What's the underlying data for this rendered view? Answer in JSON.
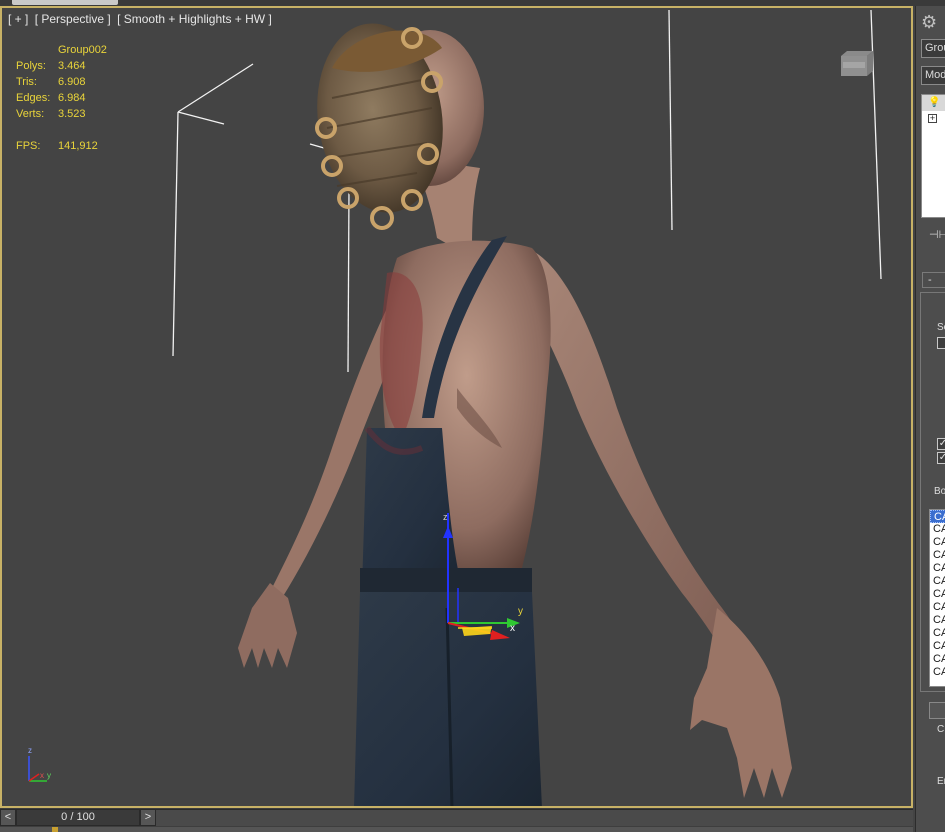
{
  "viewport": {
    "label_parts": [
      "[ + ]",
      "[ Perspective ]",
      "[ Smooth + Highlights + HW ]"
    ],
    "stats": {
      "object_name": "Group002",
      "polys_label": "Polys:",
      "polys_value": "3.464",
      "tris_label": "Tris:",
      "tris_value": "6.908",
      "edges_label": "Edges:",
      "edges_value": "6.984",
      "verts_label": "Verts:",
      "verts_value": "3.523",
      "fps_label": "FPS:",
      "fps_value": "141,912"
    },
    "gizmo_labels": {
      "x": "x",
      "y": "y",
      "z": "z"
    },
    "axis_tripod_labels": {
      "z": "z",
      "x": "x",
      "y": "y"
    }
  },
  "timeline": {
    "prev": "<",
    "frame": "0 / 100",
    "next": ">"
  },
  "command_panel": {
    "object_field": "Grou",
    "modifier_field": "Mod",
    "rollout_minus": "-",
    "section_label": "Se",
    "bones_label": "Bo",
    "bones": [
      "CA",
      "CA",
      "CA",
      "CA",
      "CA",
      "CA",
      "CA",
      "CA",
      "CA",
      "CA",
      "CA",
      "CA",
      "CA"
    ],
    "bottom_label_1": "C",
    "bottom_label_2": "Er"
  },
  "colors": {
    "viewport_border": "#c8b266",
    "stats_text": "#e9d43a",
    "viewport_bg": "#444444",
    "list_selection": "#3b6ecf"
  }
}
